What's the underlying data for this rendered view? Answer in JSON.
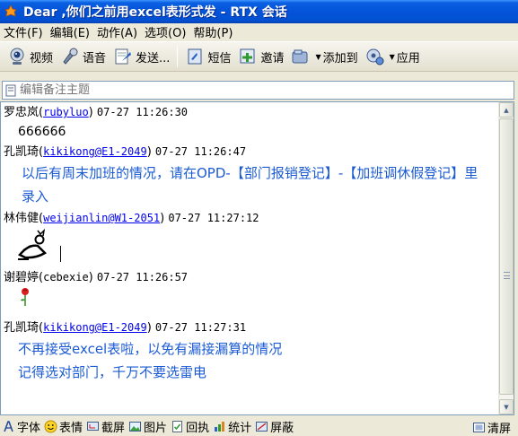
{
  "window": {
    "title": "Dear ,你们之前用excel表形式发 - RTX 会话"
  },
  "menu": [
    {
      "label": "文件(F)"
    },
    {
      "label": "编辑(E)"
    },
    {
      "label": "动作(A)"
    },
    {
      "label": "选项(O)"
    },
    {
      "label": "帮助(P)"
    }
  ],
  "toolbar": {
    "video": "视频",
    "voice": "语音",
    "send": "发送...",
    "sms": "短信",
    "invite": "邀请",
    "add_to": "添加到",
    "apps": "应用"
  },
  "subject": {
    "placeholder": "编辑备注主题"
  },
  "messages": [
    {
      "name": "罗忠岚",
      "uid": "rubyluo",
      "time": "07-27 11:26:30",
      "text": "666666"
    },
    {
      "name": "孔凯琦",
      "uid": "kikikong@E1-2049",
      "time": "07-27 11:26:47",
      "text": "以后有周末加班的情况，请在OPD-【部门报销登记】-【加班调休假登记】里录入"
    },
    {
      "name": "林伟健",
      "uid": "weijianlin@W1-2051",
      "time": "07-27 11:27:12"
    },
    {
      "name": "谢碧婷",
      "uid": "cebexie",
      "time": "07-27 11:26:57"
    },
    {
      "name": "孔凯琦",
      "uid": "kikikong@E1-2049",
      "time": "07-27 11:27:31",
      "line1": "不再接受excel表啦，以免有漏接漏算的情况",
      "line2": "记得选对部门，千万不要选雷电"
    }
  ],
  "bottom": {
    "font": "字体",
    "emoticon": "表情",
    "screenshot": "截屏",
    "image": "图片",
    "receipt": "回执",
    "stats": "统计",
    "shield": "屏蔽",
    "clear": "清屏"
  },
  "colors": {
    "accent_blue": "#1a5bd4",
    "link_blue": "#0000ee",
    "titlebar": "#0453d8"
  }
}
